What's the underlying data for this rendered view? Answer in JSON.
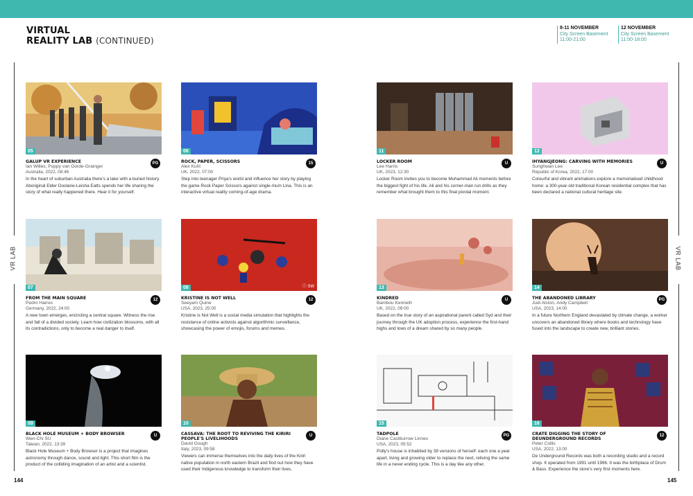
{
  "header": {
    "title_line1": "VIRTUAL",
    "title_line2": "REALITY LAB",
    "title_suffix": "(CONTINUED)",
    "schedule": [
      {
        "dates": "8-11 NOVEMBER",
        "venue": "City Screen Basement",
        "times": "11:00-21:00"
      },
      {
        "dates": "12 NOVEMBER",
        "venue": "City Screen Basement",
        "times": "11:00-18:00"
      }
    ]
  },
  "side_labels": {
    "left": "VR LAB",
    "right": "VR LAB"
  },
  "page_numbers": {
    "left": "144",
    "right": "145"
  },
  "cards": [
    {
      "num": "05",
      "title": "GALUP VR EXPERIENCE",
      "credit": "Ian Willes, Poppy van Oorde-Grainger",
      "meta": "Australia, 2022, 08:46",
      "rating": "PG",
      "desc": "In the heart of suburban Australia there's a lake with a buried history. Aboriginal Elder Doolane-Leisha Eatts spends her life sharing the story of what really happened there. Hear it for yourself."
    },
    {
      "num": "06",
      "title": "ROCK, PAPER, SCISSORS",
      "credit": "Alex Kuhl",
      "meta": "UK, 2022, 07:00",
      "rating": "15",
      "desc": "Step into teenager Priya's world and influence her story by playing the game Rock Paper Scissors against single-mum Lina. This is an interactive virtual reality coming-of-age drama."
    },
    {
      "num": "07",
      "title": "FROM THE MAIN SQUARE",
      "credit": "Pedro Harres",
      "meta": "Germany, 2022, 24:00",
      "rating": "12",
      "desc": "A new town emerges, encircling a central square. Witness the rise and fall of a divided society. Learn how civilization blossoms, with all its contradictions, only to become a real danger to itself."
    },
    {
      "num": "08",
      "title": "KRISTINE IS NOT WELL",
      "credit": "Seeyam Quine",
      "meta": "USA, 2023, 25:00",
      "rating": "12",
      "desc": "Kristine is Not Well is a social media simulation that highlights the resistance of online activists against algorithmic surveillance, showcasing the power of emojis, forums and memes."
    },
    {
      "num": "09",
      "title": "BLACK HOLE MUSEUM + BODY BROWSER",
      "credit": "Wen-Chi SU",
      "meta": "Taiwan, 2022, 13:39",
      "rating": "U",
      "desc": "Black Hole Museum + Body Browser is a project that imagines astronomy through dance, sound and light. This short film is the product of the colliding imagination of an artist and a scientist."
    },
    {
      "num": "10",
      "title": "CASSAVA: THE ROOT TO REVIVING THE KIRIRI PEOPLE'S LIVELIHOODS",
      "credit": "David Gough",
      "meta": "Italy, 2023, 09:58",
      "rating": "U",
      "desc": "Viewers can immerse themselves into the daily lives of the Kiriri native population in north eastern Brazil and find out how they have used their Indigenous knowledge to transform their lives."
    },
    {
      "num": "11",
      "title": "LOCKER ROOM",
      "credit": "Lee Harris",
      "meta": "UK, 2023, 12:30",
      "rating": "U",
      "desc": "Locker Room invites you to become Muhammad Ali moments before the biggest fight of his life. Ali and his corner-man run drills as they remember what brought them to this final pivotal moment."
    },
    {
      "num": "12",
      "title": "IHYANGJEONG: CARVING WITH MEMORIES",
      "credit": "Sunghwan Lee",
      "meta": "Republic of Korea, 2022, 17:00",
      "rating": "U",
      "desc": "Colourful and vibrant animations explore a memorialised childhood home: a 300-year-old traditional Korean residential complex that has been declared a national cultural heritage site."
    },
    {
      "num": "13",
      "title": "KINDRED",
      "credit": "Bambou Kenneth",
      "meta": "UK, 2022, 09:00",
      "rating": "U",
      "desc": "Based on the true story of an aspirational parent called Syd and their journey through the UK adoption process, experience the first-hand highs and lows of a dream shared by so many people."
    },
    {
      "num": "14",
      "title": "THE ABANDONED LIBRARY",
      "credit": "Judi Alston, Andy Campbell",
      "meta": "USA, 2023, 14:00",
      "rating": "PG",
      "desc": "In a future Northern England devastated by climate change, a worker uncovers an abandoned library where books and technology have fused into the landscape to create new, brilliant stories."
    },
    {
      "num": "15",
      "title": "TADPOLE",
      "credit": "Diane Castburrow Linnes",
      "meta": "USA, 2023, 05:52",
      "rating": "PG",
      "desc": "Polly's house is inhabited by 39 versions of herself: each one a year apart, living and growing older to replace the next, reliving the same life in a never ending cycle. This is a day like any other."
    },
    {
      "num": "16",
      "title": "CRATE DIGGING THE STORY OF DEUNDERGROUND RECORDS",
      "credit": "Peter Collis",
      "meta": "USA, 2022, 13:00",
      "rating": "12",
      "desc": "De Underground Records was both a recording studio and a record shop. It operated from 1991 until 1996. It was the birthplace of Drum & Bass. Experience the store's very first moments here."
    }
  ],
  "colors": {
    "accent": "#3fb8b0",
    "rating_badge": "#111111"
  }
}
